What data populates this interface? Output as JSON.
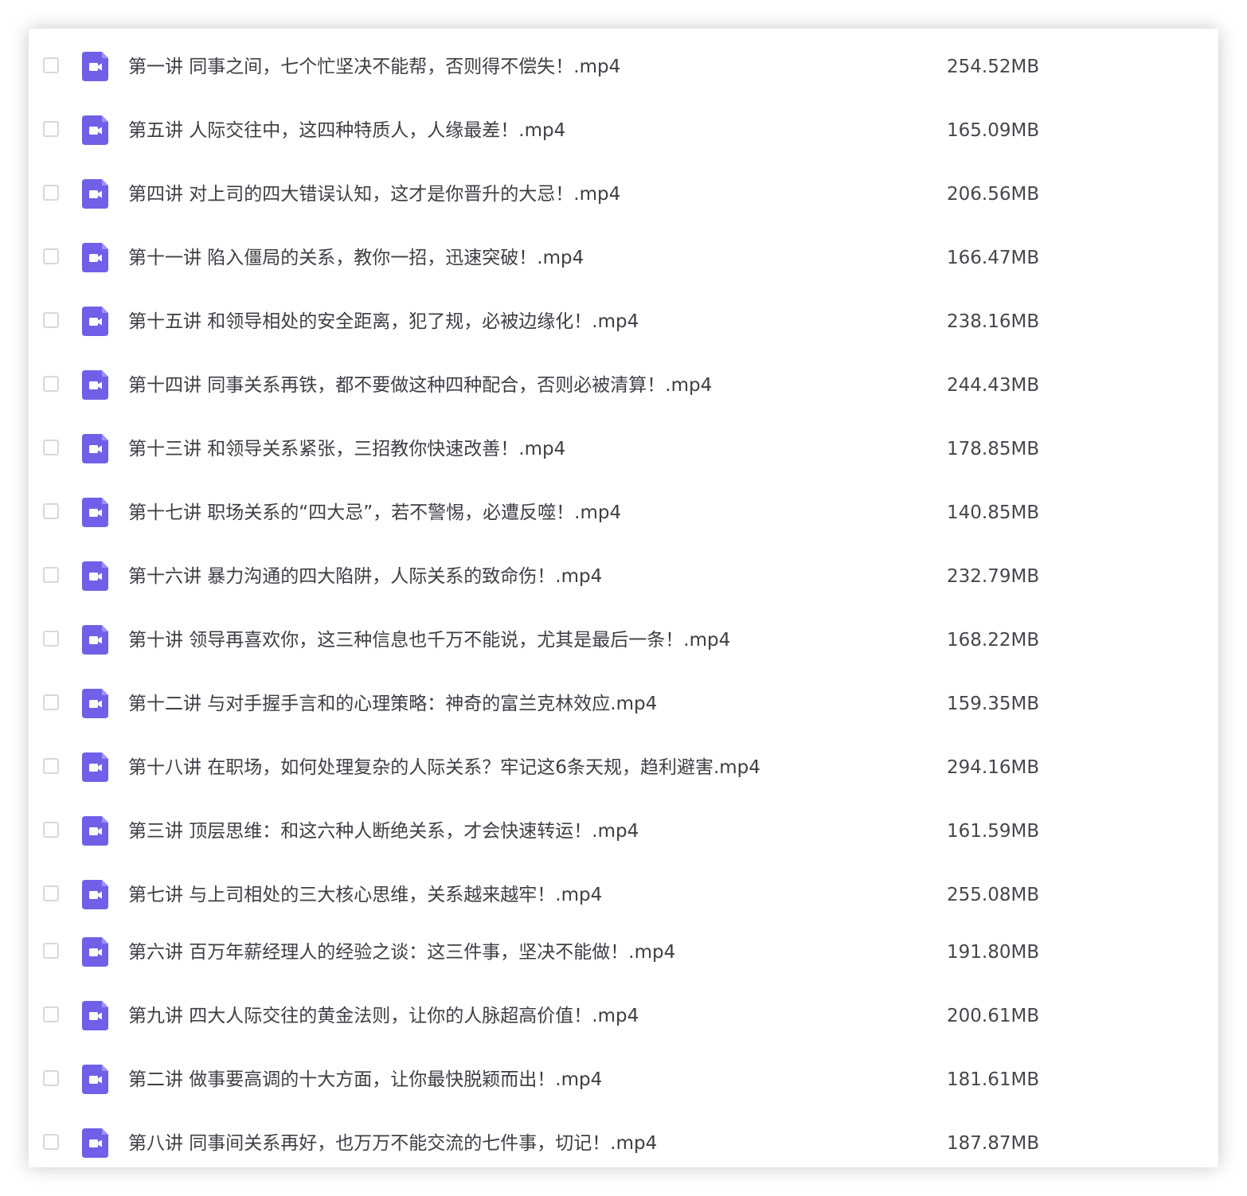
{
  "accent_color": "#7060e8",
  "file_icon": "video-file-icon",
  "files": [
    {
      "name": "第一讲 同事之间，七个忙坚决不能帮，否则得不偿失！.mp4",
      "size": "254.52MB"
    },
    {
      "name": "第五讲 人际交往中，这四种特质人，人缘最差！.mp4",
      "size": "165.09MB"
    },
    {
      "name": "第四讲 对上司的四大错误认知，这才是你晋升的大忌！.mp4",
      "size": "206.56MB"
    },
    {
      "name": "第十一讲 陷入僵局的关系，教你一招，迅速突破！.mp4",
      "size": "166.47MB"
    },
    {
      "name": "第十五讲 和领导相处的安全距离，犯了规，必被边缘化！.mp4",
      "size": "238.16MB"
    },
    {
      "name": "第十四讲 同事关系再铁，都不要做这种四种配合，否则必被清算！.mp4",
      "size": "244.43MB"
    },
    {
      "name": "第十三讲 和领导关系紧张，三招教你快速改善！.mp4",
      "size": "178.85MB"
    },
    {
      "name": "第十七讲 职场关系的“四大忌”，若不警惕，必遭反噬！.mp4",
      "size": "140.85MB"
    },
    {
      "name": "第十六讲 暴力沟通的四大陷阱，人际关系的致命伤！.mp4",
      "size": "232.79MB"
    },
    {
      "name": "第十讲 领导再喜欢你，这三种信息也千万不能说，尤其是最后一条！.mp4",
      "size": "168.22MB"
    },
    {
      "name": "第十二讲 与对手握手言和的心理策略：神奇的富兰克林效应.mp4",
      "size": "159.35MB"
    },
    {
      "name": "第十八讲 在职场，如何处理复杂的人际关系？牢记这6条天规，趋利避害.mp4",
      "size": "294.16MB"
    },
    {
      "name": "第三讲 顶层思维：和这六种人断绝关系，才会快速转运！.mp4",
      "size": "161.59MB"
    },
    {
      "name": "第七讲 与上司相处的三大核心思维，关系越来越牢！.mp4",
      "size": "255.08MB"
    },
    {
      "name": "第六讲 百万年薪经理人的经验之谈：这三件事，坚决不能做！.mp4",
      "size": "191.80MB"
    },
    {
      "name": "第九讲 四大人际交往的黄金法则，让你的人脉超高价值！.mp4",
      "size": "200.61MB"
    },
    {
      "name": "第二讲 做事要高调的十大方面，让你最快脱颖而出！.mp4",
      "size": "181.61MB"
    },
    {
      "name": "第八讲 同事间关系再好，也万万不能交流的七件事，切记！.mp4",
      "size": "187.87MB"
    }
  ]
}
